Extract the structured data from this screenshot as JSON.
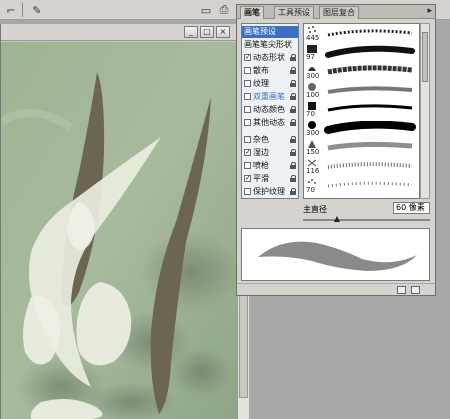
{
  "panel": {
    "tabs": [
      {
        "label": "画笔"
      },
      {
        "label": "工具预设"
      },
      {
        "label": "图层复合"
      }
    ],
    "menu_arrow": "▸",
    "left_items": [
      {
        "label": "画笔预设",
        "checked": null,
        "locked": false,
        "selected": true
      },
      {
        "label": "画笔笔尖形状",
        "checked": null,
        "locked": false,
        "selected": false
      },
      {
        "label": "动态形状",
        "checked": true,
        "locked": true,
        "selected": false
      },
      {
        "label": "散布",
        "checked": false,
        "locked": true,
        "selected": false
      },
      {
        "label": "纹理",
        "checked": false,
        "locked": true,
        "selected": false
      },
      {
        "label": "双重画笔",
        "checked": false,
        "locked": true,
        "selected": false
      },
      {
        "label": "动态颜色",
        "checked": false,
        "locked": true,
        "selected": false
      },
      {
        "label": "其他动态",
        "checked": false,
        "locked": true,
        "selected": false
      },
      {
        "label": "杂色",
        "checked": false,
        "locked": true,
        "selected": false
      },
      {
        "label": "湿边",
        "checked": true,
        "locked": true,
        "selected": false
      },
      {
        "label": "喷枪",
        "checked": false,
        "locked": true,
        "selected": false
      },
      {
        "label": "平滑",
        "checked": true,
        "locked": true,
        "selected": false
      },
      {
        "label": "保护纹理",
        "checked": false,
        "locked": true,
        "selected": false
      }
    ],
    "brushes": [
      {
        "size": "445",
        "kind": "splatter"
      },
      {
        "size": "97",
        "kind": "thick"
      },
      {
        "size": "300",
        "kind": "leafy"
      },
      {
        "size": "100",
        "kind": "rough"
      },
      {
        "size": "70",
        "kind": "ink"
      },
      {
        "size": "300",
        "kind": "heavy"
      },
      {
        "size": "150",
        "kind": "soft"
      },
      {
        "size": "116",
        "kind": "bristle"
      },
      {
        "size": "70",
        "kind": "dots"
      }
    ],
    "diameter_label": "主直径",
    "diameter_value": "60 像素",
    "diameter_fraction": 0.27
  },
  "window_buttons": [
    "_",
    "□",
    "×"
  ],
  "colors": {
    "selection_blue": "#3d6fc1",
    "canvas_green": "#a7b99c",
    "leaf_dark": "#6b6552",
    "stroke_white": "#eef1e6"
  }
}
